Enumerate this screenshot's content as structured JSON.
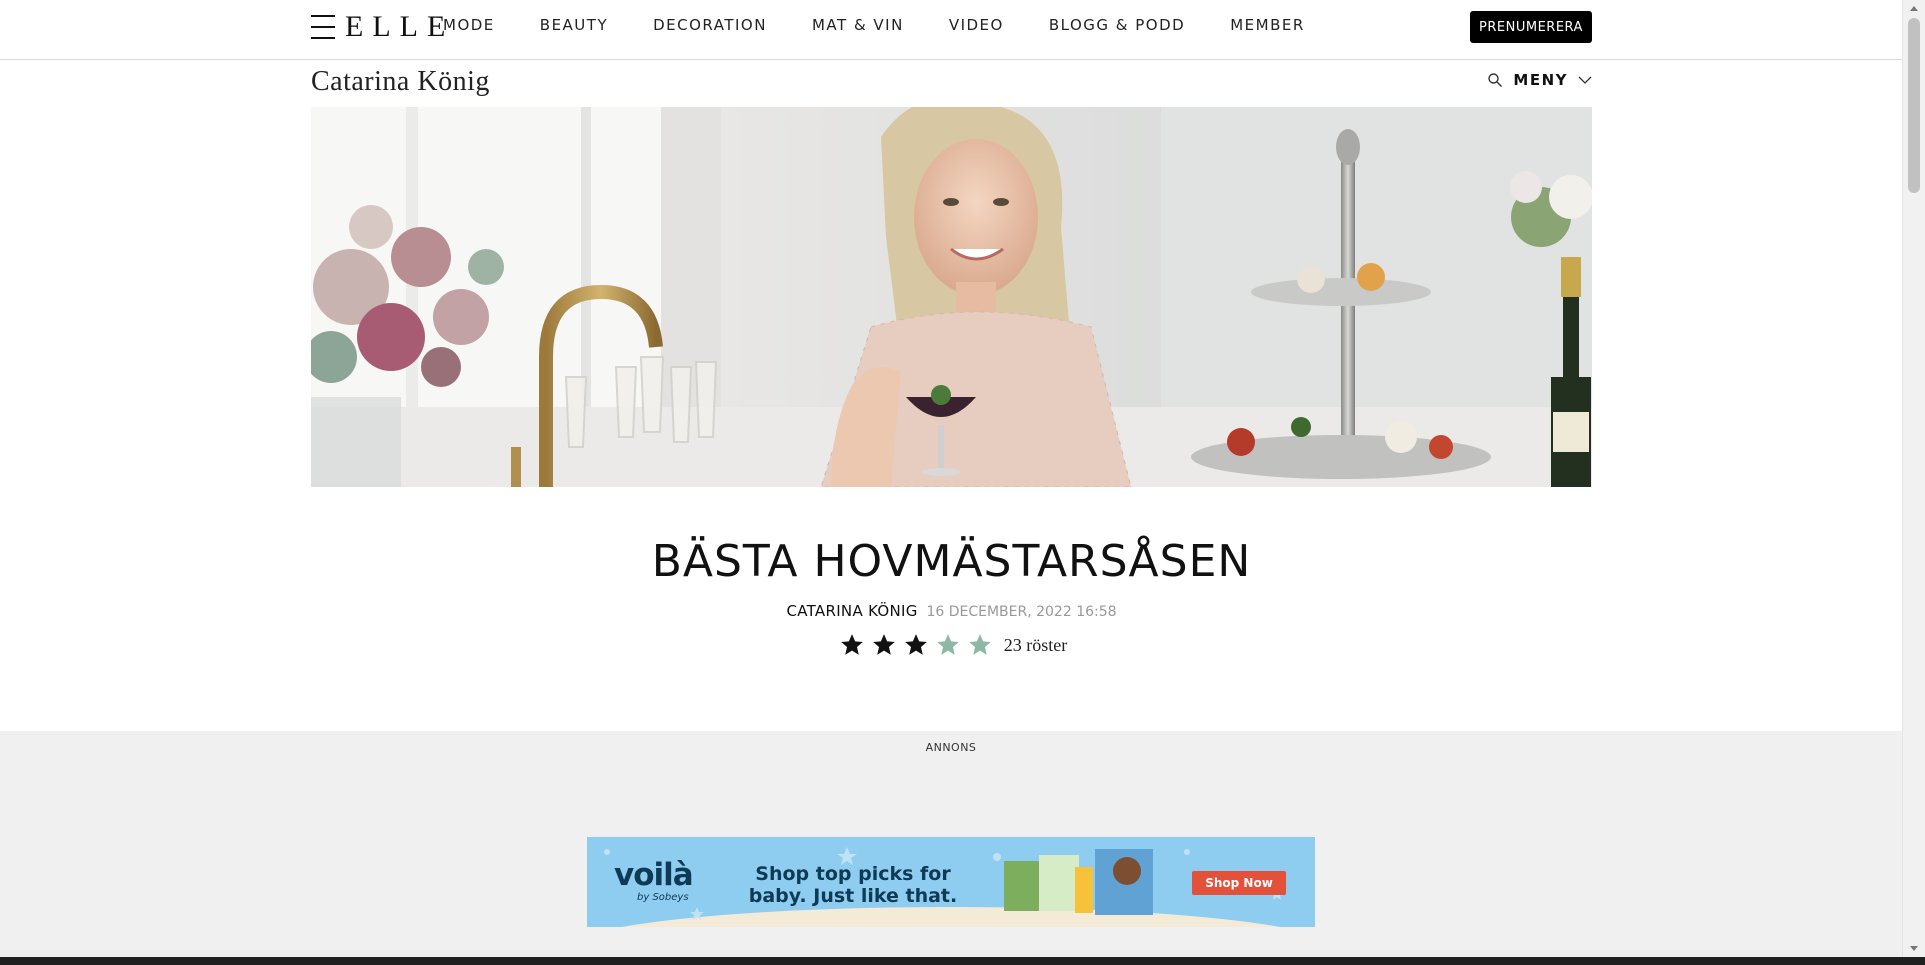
{
  "header": {
    "logo": "ELLE",
    "nav": [
      "MODE",
      "BEAUTY",
      "DECORATION",
      "MAT & VIN",
      "VIDEO",
      "BLOGG & PODD",
      "MEMBER"
    ],
    "subscribe_label": "PRENUMERERA"
  },
  "blog": {
    "title": "Catarina König",
    "menu_label": "MENY",
    "icons": [
      "search-icon",
      "chevron-down-icon"
    ]
  },
  "hero": {
    "icons": [
      "vase-of-flowers",
      "brass-faucet",
      "champagne-flutes",
      "woman-with-dessert-glass",
      "cake-stand",
      "champagne-bottle"
    ]
  },
  "article": {
    "title": "BÄSTA HOVMÄSTARSÅSEN",
    "author": "CATARINA KÖNIG",
    "date": "16 DECEMBER, 2022 16:58",
    "rating": {
      "value": 3,
      "max": 5,
      "votes_label": "23 röster"
    }
  },
  "ad": {
    "label": "ANNONS",
    "brand": "voilà",
    "brand_by": "by Sobeys",
    "headline": "Shop top picks for baby. Just like that.",
    "cta": "Shop Now"
  },
  "colors": {
    "accent": "#000000",
    "star_filled": "#111111",
    "star_empty": "#8fb8a4",
    "ad_bg": "#8ecdf0",
    "ad_cta": "#e4513a",
    "ad_zone_bg": "#f0f0f0"
  }
}
